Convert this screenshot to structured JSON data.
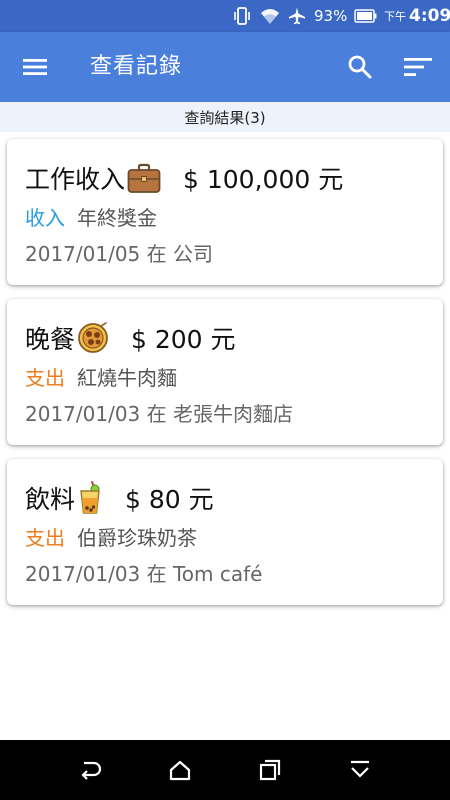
{
  "status_bar": {
    "battery": "93%",
    "ampm": "下午",
    "time": "4:09"
  },
  "app_bar": {
    "title": "查看記錄",
    "menu_icon": "menu-icon",
    "search_icon": "search-icon",
    "sort_icon": "sort-icon"
  },
  "results": {
    "label": "查詢結果(3)"
  },
  "records": [
    {
      "title": "工作收入",
      "icon": "briefcase-icon",
      "amount": "$ 100,000 元",
      "type": "收入",
      "note": "年終獎金",
      "date_place": "2017/01/05 在 公司"
    },
    {
      "title": "晚餐",
      "icon": "meal-plate-icon",
      "amount": "$ 200 元",
      "type": "支出",
      "note": "紅燒牛肉麵",
      "date_place": "2017/01/03 在 老張牛肉麵店"
    },
    {
      "title": "飲料",
      "icon": "drink-cup-icon",
      "amount": "$ 80 元",
      "type": "支出",
      "note": "伯爵珍珠奶茶",
      "date_place": "2017/01/03 在 Tom café"
    }
  ],
  "colors": {
    "status_bar": "#3a68c4",
    "app_bar": "#4a7fdc",
    "income": "#2a9be0",
    "expense": "#ef7d1c"
  }
}
